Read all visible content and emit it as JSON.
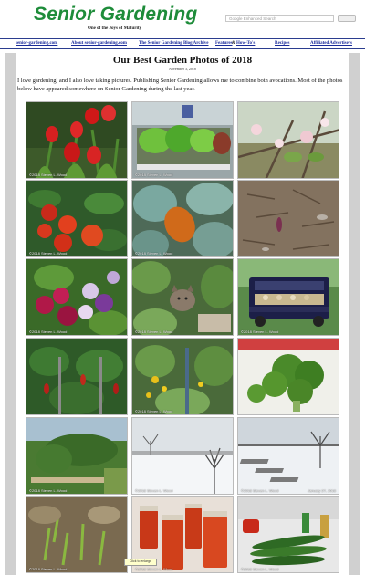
{
  "site": {
    "title": "Senior Gardening",
    "tagline": "One of the Joys of Maturity",
    "search_placeholder": "Google Enhanced Search",
    "search_button": "Search"
  },
  "nav": {
    "items": [
      "senior-gardening.com",
      "About senior-gardening.com",
      "The Senior Gardening Blog Archive",
      "Features",
      "&",
      "How-To's",
      "Recipes",
      "Affiliated Advertisers"
    ]
  },
  "article": {
    "title": "Our Best Garden Photos of 2018",
    "date": "November 3, 2018",
    "intro": "I love gardening, and I also love taking pictures. Publishing Senior Gardening allows me to combine both avocations. Most of the photos below have appeared somewhere on Senior Gardening during the last year."
  },
  "photos": {
    "credit": "©2018 Steven L. Wood",
    "credit_date": "January 27, 2018",
    "tooltip": "Click to enlarge"
  }
}
